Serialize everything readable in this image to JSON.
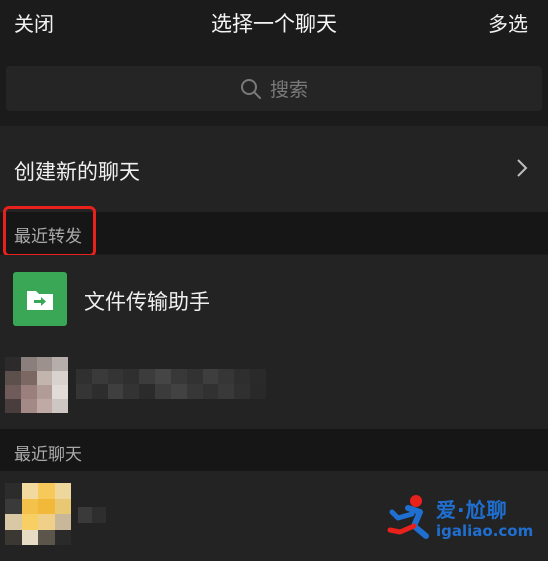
{
  "header": {
    "close_label": "关闭",
    "title": "选择一个聊天",
    "multi_select_label": "多选"
  },
  "search": {
    "placeholder": "搜索",
    "icon": "search-icon"
  },
  "new_chat": {
    "label": "创建新的聊天",
    "icon": "chevron-right-icon"
  },
  "sections": {
    "recent_forward": {
      "label": "最近转发"
    },
    "recent_chats": {
      "label": "最近聊天"
    }
  },
  "recent_forward_items": [
    {
      "label": "文件传输助手",
      "icon": "file-transfer-icon",
      "avatar_color": "#3aa757"
    }
  ],
  "watermark": {
    "brand": "爱·尬聊",
    "url": "igaliao.com"
  },
  "colors": {
    "background": "#1b1b1b",
    "row": "#232323",
    "section": "#161616",
    "highlight": "#e8211c",
    "brand_green": "#3aa757",
    "watermark": "#1f6fd1"
  }
}
